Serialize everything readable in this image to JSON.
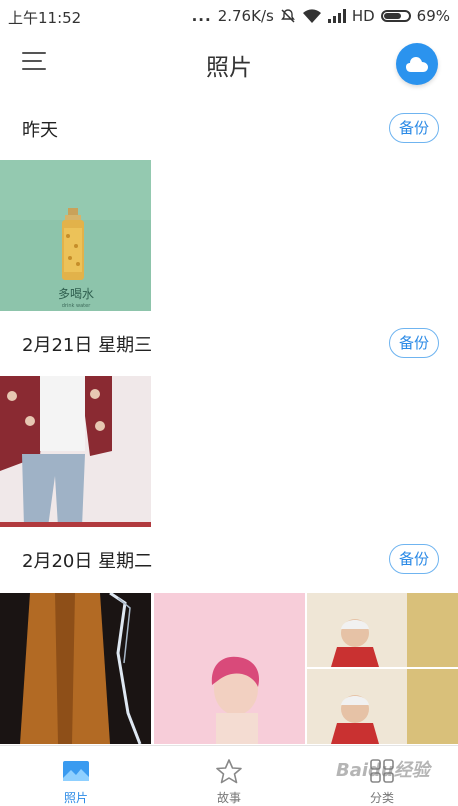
{
  "status_bar": {
    "time": "上午11:52",
    "dots": "...",
    "speed": "2.76K/s",
    "network": "HD",
    "battery": "69%",
    "battery_level": 0.69
  },
  "header": {
    "title": "照片",
    "menu_icon": "hamburger-menu-icon",
    "cloud_icon": "cloud-icon"
  },
  "sections": [
    {
      "title": "昨天",
      "backup_label": "备份",
      "photo_caption": "多喝水",
      "photo_subcaption": "drink water"
    },
    {
      "title": "2月21日 星期三",
      "backup_label": "备份"
    },
    {
      "title": "2月20日 星期二",
      "backup_label": "备份"
    }
  ],
  "bottom_nav": [
    {
      "label": "照片",
      "icon": "photo-icon",
      "active": true
    },
    {
      "label": "故事",
      "icon": "star-icon",
      "active": false
    },
    {
      "label": "分类",
      "icon": "category-grid-icon",
      "active": false
    }
  ],
  "watermark": "Baidu经验",
  "colors": {
    "accent": "#2b93ee"
  }
}
